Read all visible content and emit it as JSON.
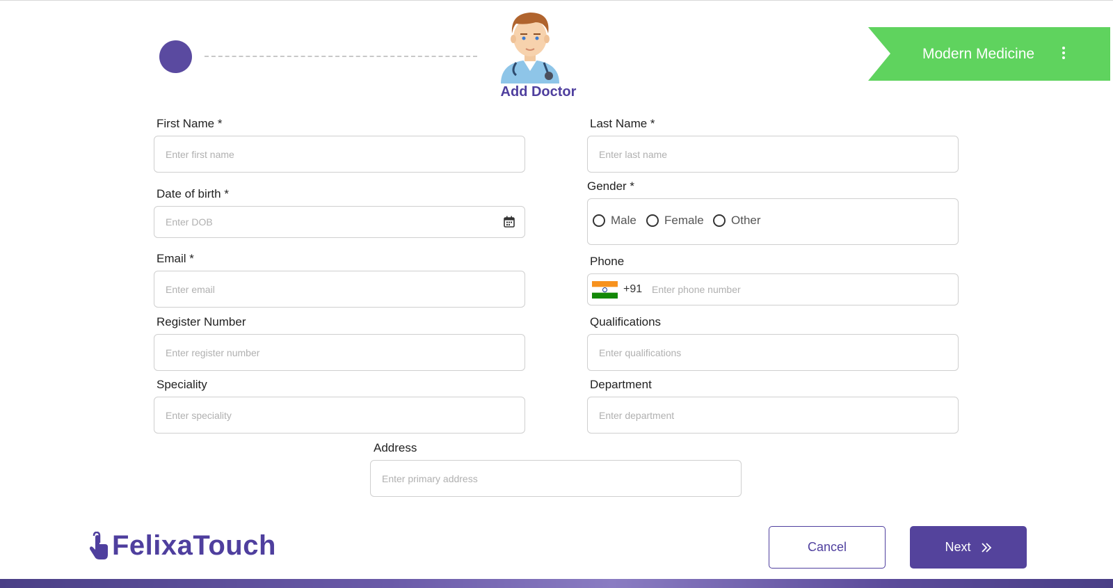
{
  "page": {
    "title": "Add Doctor",
    "brand_color": "#5a4aa0",
    "ribbon_color": "#5fd35e"
  },
  "ribbon": {
    "label": "Modern Medicine",
    "menu_icon": "more-vertical-icon"
  },
  "form": {
    "first_name": {
      "label": "First Name *",
      "placeholder": "Enter first name",
      "value": ""
    },
    "last_name": {
      "label": "Last Name *",
      "placeholder": "Enter last name",
      "value": ""
    },
    "dob": {
      "label": "Date of birth *",
      "placeholder": "Enter DOB",
      "value": "",
      "icon": "calendar-icon"
    },
    "gender": {
      "label": "Gender *",
      "options": [
        "Male",
        "Female",
        "Other"
      ],
      "selected": null
    },
    "email": {
      "label": "Email *",
      "placeholder": "Enter email",
      "value": ""
    },
    "phone": {
      "label": "Phone",
      "dial_code": "+91",
      "placeholder": "Enter phone number",
      "value": "",
      "flag": "india-flag-icon"
    },
    "register_number": {
      "label": "Register Number",
      "placeholder": "Enter register number",
      "value": ""
    },
    "qualifications": {
      "label": "Qualifications",
      "placeholder": "Enter qualifications",
      "value": ""
    },
    "speciality": {
      "label": "Speciality",
      "placeholder": "Enter speciality",
      "value": ""
    },
    "department": {
      "label": "Department",
      "placeholder": "Enter department",
      "value": ""
    },
    "address": {
      "label": "Address",
      "placeholder": "Enter primary address",
      "value": ""
    }
  },
  "footer": {
    "logo_text": "FelixaTouch",
    "cancel_label": "Cancel",
    "next_label": "Next"
  }
}
